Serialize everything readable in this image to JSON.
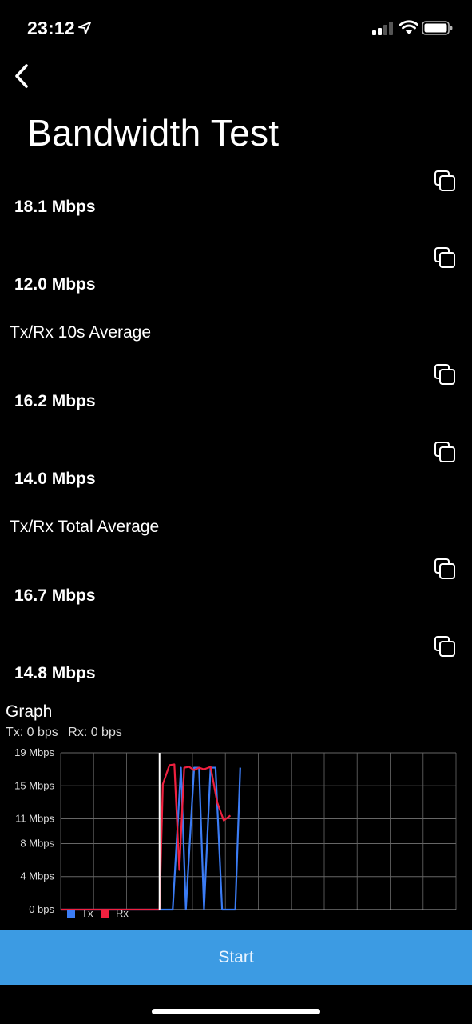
{
  "status_bar": {
    "time": "23:12",
    "icons": [
      "location-arrow-icon",
      "cellular-signal-icon",
      "wifi-icon",
      "battery-icon"
    ]
  },
  "nav": {
    "back_icon": "chevron-left-icon",
    "title": "Bandwidth Test"
  },
  "current": {
    "tx": "18.1 Mbps",
    "rx": "12.0 Mbps"
  },
  "avg10": {
    "label": "Tx/Rx 10s Average",
    "tx": "16.2 Mbps",
    "rx": "14.0 Mbps"
  },
  "total": {
    "label": "Tx/Rx Total Average",
    "tx": "16.7 Mbps",
    "rx": "14.8 Mbps"
  },
  "copy_icon": "copy-icon",
  "graph": {
    "title": "Graph",
    "tx_status": "Tx: 0 bps",
    "rx_status": "Rx: 0 bps"
  },
  "chart_data": {
    "type": "line",
    "y_tick_labels": [
      "19 Mbps",
      "15 Mbps",
      "11 Mbps",
      "8 Mbps",
      "4 Mbps",
      "0 bps"
    ],
    "y_tick_values": [
      19,
      15,
      11,
      8,
      4,
      0
    ],
    "ylim": [
      0,
      19
    ],
    "x_range": [
      0,
      12
    ],
    "grid": true,
    "legend_placement": "bottom-left",
    "series": [
      {
        "name": "Tx",
        "color": "#3b7cf5",
        "points": [
          [
            0,
            0
          ],
          [
            3.0,
            0
          ],
          [
            3.4,
            0
          ],
          [
            3.65,
            17.2
          ],
          [
            3.8,
            0
          ],
          [
            4.05,
            17.2
          ],
          [
            4.2,
            17.2
          ],
          [
            4.35,
            0
          ],
          [
            4.55,
            17.2
          ],
          [
            4.7,
            17.2
          ],
          [
            4.9,
            0
          ],
          [
            5.3,
            0
          ],
          [
            5.45,
            17.2
          ]
        ]
      },
      {
        "name": "Rx",
        "color": "#f0203f",
        "points": [
          [
            0,
            0
          ],
          [
            3.0,
            0
          ],
          [
            3.1,
            15.2
          ],
          [
            3.3,
            17.5
          ],
          [
            3.45,
            17.6
          ],
          [
            3.6,
            4.8
          ],
          [
            3.75,
            17.2
          ],
          [
            3.9,
            17.3
          ],
          [
            4.05,
            16.9
          ],
          [
            4.2,
            17.2
          ],
          [
            4.35,
            17.0
          ],
          [
            4.55,
            17.3
          ],
          [
            4.75,
            13.0
          ],
          [
            4.95,
            10.8
          ],
          [
            5.15,
            11.4
          ]
        ]
      }
    ],
    "marker_x": 3.0,
    "legend": [
      "Tx",
      "Rx"
    ]
  },
  "start_button": {
    "label": "Start"
  }
}
